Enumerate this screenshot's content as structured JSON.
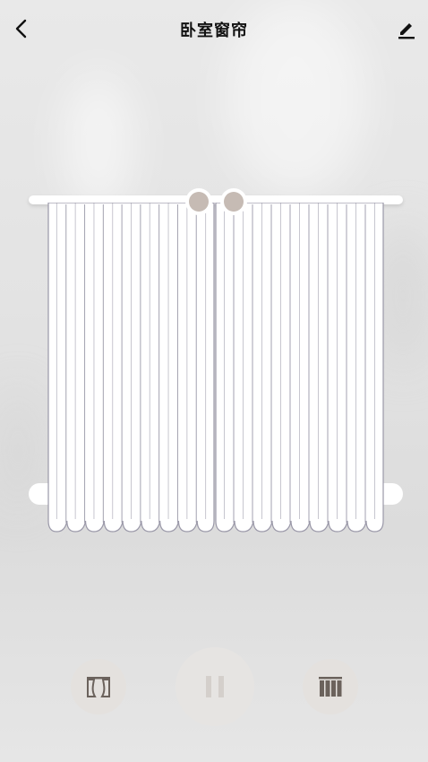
{
  "header": {
    "title": "卧室窗帘",
    "back_icon": "chevron-left-icon",
    "edit_icon": "pencil-icon"
  },
  "curtain": {
    "open_fraction": 0,
    "fabric_color": "#ffffff",
    "fold_line_color": "#9a98a8",
    "ring_color": "#c6bbb4"
  },
  "controls": {
    "open_icon": "curtain-open-icon",
    "pause_icon": "pause-icon",
    "close_icon": "curtain-close-icon",
    "icon_color": "#6b625c",
    "pause_icon_color": "#d4cfcb"
  }
}
